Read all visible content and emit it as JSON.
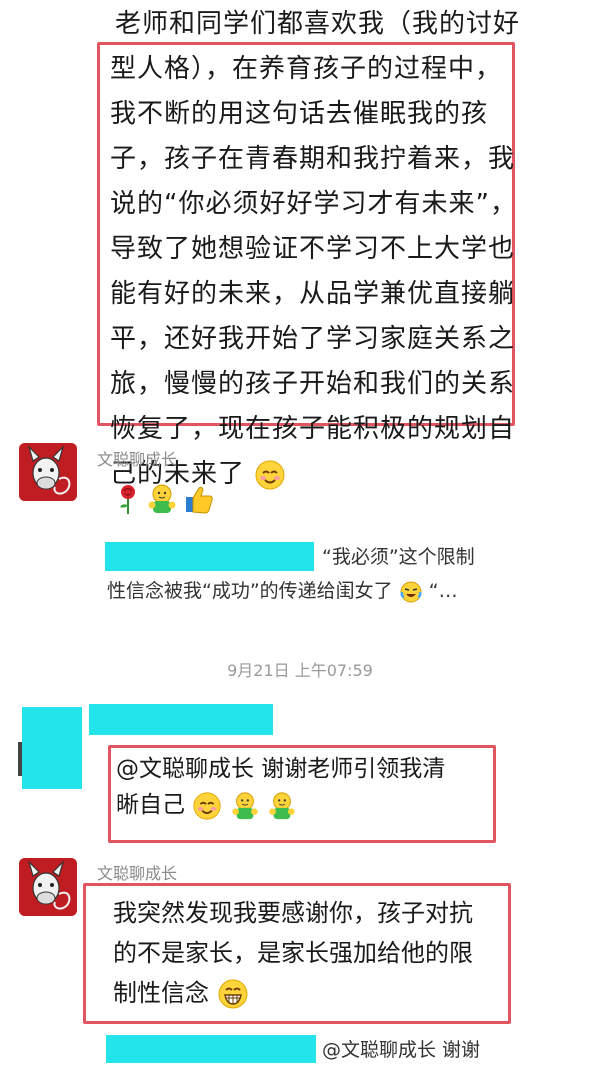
{
  "first_message": {
    "lead_line": "老师和同学们都喜欢我（我的讨好",
    "boxed_lines": [
      "型人格），在养育孩子的过程中，",
      "我不断的用这句话去催眠我的孩",
      "子，孩子在青春期和我拧着来，我",
      "说的“你必须好好学习才有未来”，",
      "导致了她想验证不学习不上大学也",
      "能有好的未来，从品学兼优直接躺",
      "平，还好我开始了学习家庭关系之",
      "旅，慢慢的孩子开始和我们的关系",
      "恢复了，现在孩子能积极的规划自",
      "己的未来了"
    ],
    "end_emoji": "smile-emoji"
  },
  "message2": {
    "sender": "文聪聊成长",
    "emojis": [
      "rose-emoji",
      "hug-emoji",
      "thumbs-up-emoji"
    ]
  },
  "quote1": {
    "lines": [
      "“我必须”这个限制",
      "性信念被我“成功”的传递给闺女了",
      "“…"
    ]
  },
  "timestamp": "9月21日 上午07:59",
  "message3": {
    "lines": [
      "@文聪聊成长  谢谢老师引领我清",
      "晰自己"
    ],
    "emojis": [
      "smile-emoji",
      "hug-emoji",
      "hug-emoji"
    ]
  },
  "message4": {
    "sender": "文聪聊成长",
    "lines": [
      "我突然发现我要感谢你，孩子对抗",
      "的不是家长，是家长强加给他的限",
      "制性信念"
    ],
    "emoji": "grin-emoji"
  },
  "quote2": {
    "text": "@文聪聊成长 谢谢"
  },
  "colors": {
    "highlight_box": "#e0555f",
    "redaction": "#22e4ea",
    "avatar_bg": "#c01d22"
  }
}
